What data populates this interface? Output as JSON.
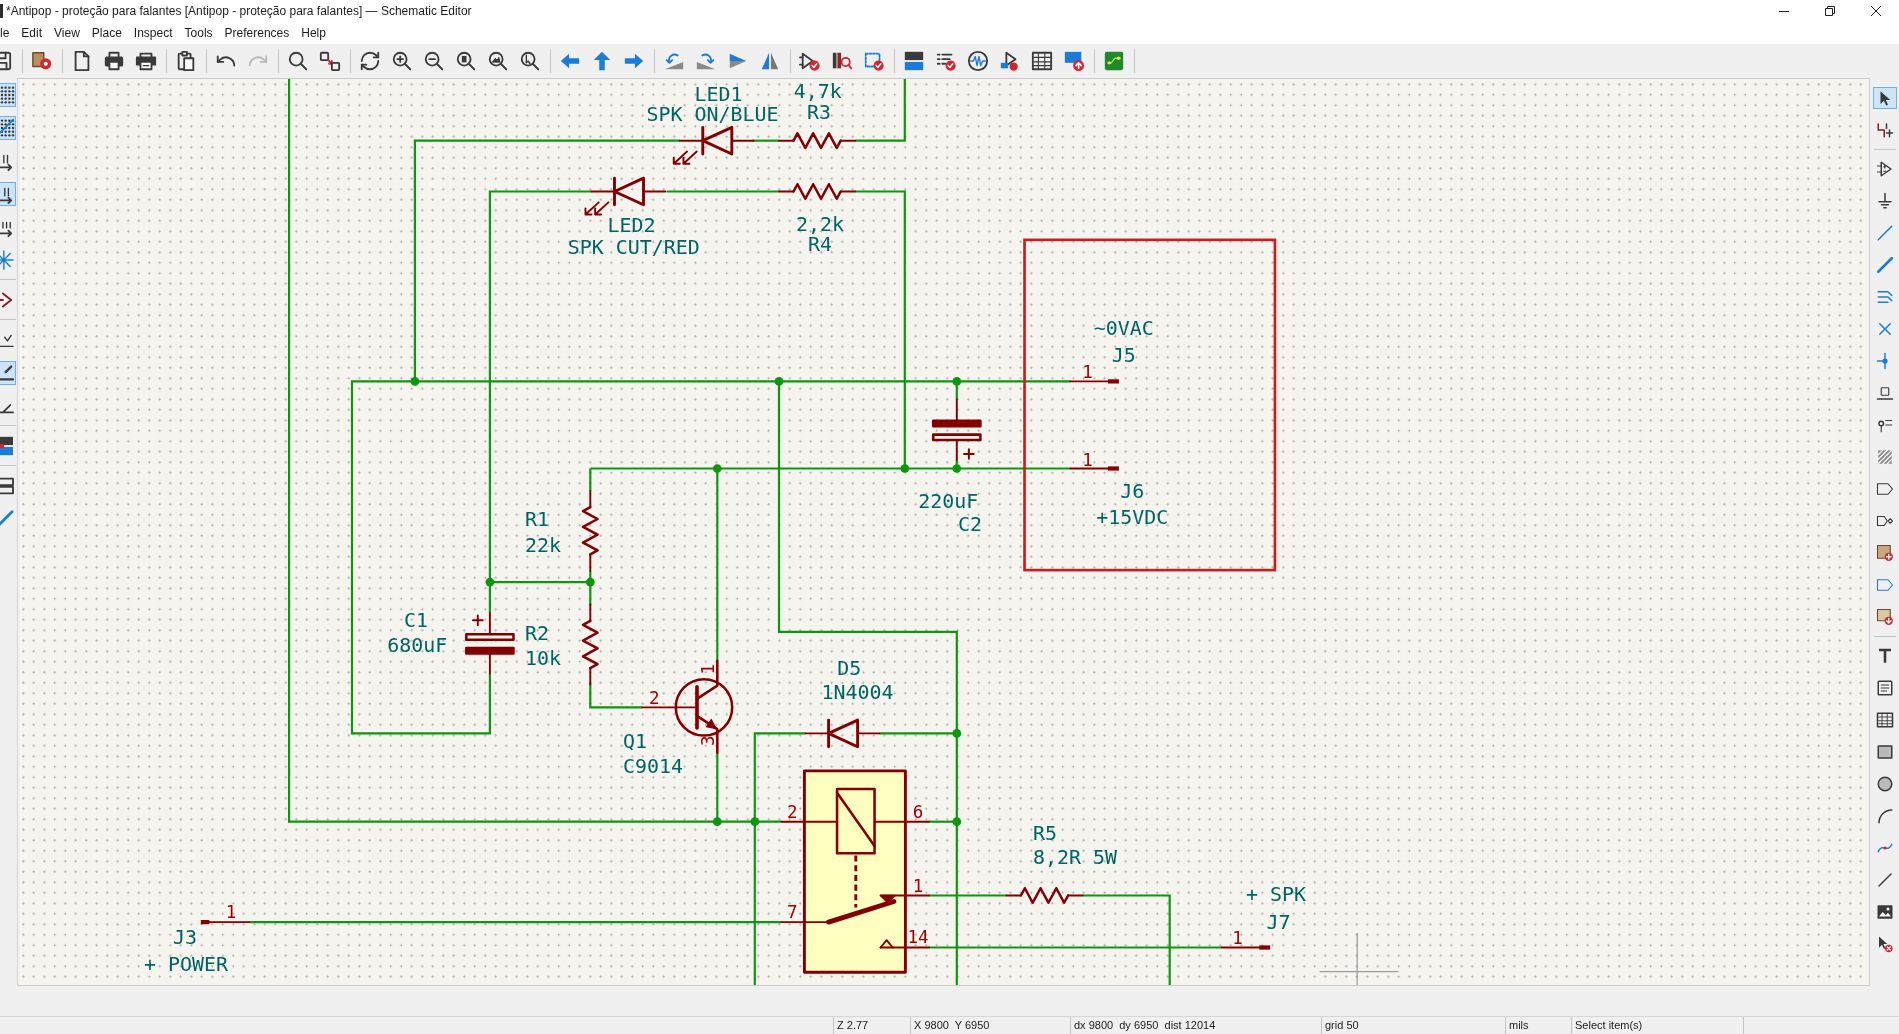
{
  "window": {
    "title": "*Antipop - proteção para falantes [Antipop - proteção para falantes] — Schematic Editor"
  },
  "menu_bar": [
    "le",
    "Edit",
    "View",
    "Place",
    "Inspect",
    "Tools",
    "Preferences",
    "Help"
  ],
  "toolbar": {
    "groups": [
      [
        {
          "kind": "save",
          "disabled": false
        }
      ],
      [
        {
          "kind": "symbol-settings",
          "disabled": false
        }
      ],
      [
        {
          "kind": "new-page",
          "disabled": false
        },
        {
          "kind": "print",
          "disabled": false
        },
        {
          "kind": "plot",
          "disabled": false
        }
      ],
      [
        {
          "kind": "paste",
          "disabled": false
        }
      ],
      [
        {
          "kind": "undo",
          "disabled": false
        },
        {
          "kind": "redo",
          "disabled": true
        }
      ],
      [
        {
          "kind": "find",
          "disabled": false
        },
        {
          "kind": "find-replace",
          "disabled": false
        }
      ],
      [
        {
          "kind": "refresh",
          "disabled": false
        },
        {
          "kind": "zoom-in",
          "disabled": false
        },
        {
          "kind": "zoom-out",
          "disabled": false
        },
        {
          "kind": "zoom-fit",
          "disabled": false
        },
        {
          "kind": "zoom-objects",
          "disabled": false
        },
        {
          "kind": "zoom-selection",
          "disabled": false
        }
      ],
      [
        {
          "kind": "nav-back",
          "disabled": false
        },
        {
          "kind": "nav-up",
          "disabled": false
        },
        {
          "kind": "nav-forward",
          "disabled": false
        }
      ],
      [
        {
          "kind": "rotate-ccw",
          "disabled": false
        },
        {
          "kind": "rotate-cw",
          "disabled": false
        },
        {
          "kind": "mirror-x",
          "disabled": false
        },
        {
          "kind": "mirror-y",
          "disabled": false
        }
      ],
      [
        {
          "kind": "erc",
          "disabled": false
        },
        {
          "kind": "library",
          "disabled": false
        },
        {
          "kind": "symbol-checker",
          "disabled": false
        }
      ],
      [
        {
          "kind": "annotate",
          "disabled": false
        },
        {
          "kind": "erc-list",
          "disabled": false
        },
        {
          "kind": "simulator",
          "disabled": false
        },
        {
          "kind": "symbol-fields",
          "disabled": false
        },
        {
          "kind": "table",
          "disabled": false
        },
        {
          "kind": "bom",
          "disabled": false
        }
      ],
      [
        {
          "kind": "pcb",
          "disabled": false
        }
      ]
    ]
  },
  "left_toolbar": {
    "groups": [
      [
        {
          "kind": "grid",
          "selected": true
        },
        {
          "kind": "grid-overrides",
          "selected": true
        },
        {
          "kind": "units-inch",
          "selected": false
        },
        {
          "kind": "units-mil",
          "selected": true
        },
        {
          "kind": "units-mm",
          "selected": false
        },
        {
          "kind": "cursor",
          "selected": false
        }
      ],
      [
        {
          "kind": "pins",
          "selected": false
        }
      ],
      [
        {
          "kind": "line-free",
          "selected": false
        },
        {
          "kind": "line-90",
          "selected": true
        },
        {
          "kind": "line-45",
          "selected": false
        }
      ],
      [
        {
          "kind": "annotate",
          "selected": false
        }
      ],
      [
        {
          "kind": "hierarchy",
          "selected": false
        },
        {
          "kind": "properties",
          "selected": false
        }
      ]
    ]
  },
  "schematic": {
    "symbols": [
      {
        "kind": "led",
        "reference": "LED1",
        "value": "SPK ON/BLUE"
      },
      {
        "kind": "resistor",
        "reference": "R3",
        "value": "4,7k"
      },
      {
        "kind": "led",
        "reference": "LED2",
        "value": "SPK CUT/RED"
      },
      {
        "kind": "resistor",
        "reference": "R4",
        "value": "2,2k"
      },
      {
        "kind": "connector",
        "reference": "J5",
        "value": "~0VAC",
        "pins": [
          "1"
        ]
      },
      {
        "kind": "capacitor",
        "reference": "C2",
        "value": "220uF"
      },
      {
        "kind": "connector",
        "reference": "J6",
        "value": "+15VDC",
        "pins": [
          "1"
        ]
      },
      {
        "kind": "resistor",
        "reference": "R1",
        "value": "22k"
      },
      {
        "kind": "capacitor",
        "reference": "C1",
        "value": "680uF"
      },
      {
        "kind": "resistor",
        "reference": "R2",
        "value": "10k"
      },
      {
        "kind": "transistor",
        "reference": "Q1",
        "value": "C9014",
        "pins": [
          "2",
          "1",
          "3"
        ]
      },
      {
        "kind": "diode",
        "reference": "D5",
        "value": "1N4004"
      },
      {
        "kind": "relay",
        "pins": [
          "2",
          "6",
          "1",
          "7",
          "14"
        ]
      },
      {
        "kind": "resistor",
        "reference": "R5",
        "value": "8,2R 5W"
      },
      {
        "kind": "connector",
        "reference": "J3",
        "value": "+ POWER",
        "pins": [
          "1"
        ]
      },
      {
        "kind": "connector",
        "reference": "J7",
        "value": "+ SPK",
        "pins": [
          "1"
        ]
      }
    ]
  },
  "right_toolbar": {
    "groups": [
      [
        {
          "kind": "select",
          "selected": true
        },
        {
          "kind": "net-highlight",
          "selected": false
        }
      ],
      [
        {
          "kind": "symbol",
          "selected": false
        },
        {
          "kind": "power",
          "selected": false
        },
        {
          "kind": "wire",
          "selected": false
        },
        {
          "kind": "bus",
          "selected": false
        },
        {
          "kind": "bus-entry",
          "selected": false
        },
        {
          "kind": "no-connect",
          "selected": false
        },
        {
          "kind": "junction",
          "selected": false
        },
        {
          "kind": "label",
          "selected": false
        },
        {
          "kind": "netclass",
          "selected": false
        },
        {
          "kind": "rule-area",
          "selected": false
        },
        {
          "kind": "global-label",
          "selected": false
        },
        {
          "kind": "hier-label",
          "selected": false
        },
        {
          "kind": "sheet",
          "selected": false
        },
        {
          "kind": "import-pin",
          "selected": false
        },
        {
          "kind": "sheet-pin",
          "selected": false
        }
      ],
      [
        {
          "kind": "text",
          "selected": false
        },
        {
          "kind": "textbox",
          "selected": false
        },
        {
          "kind": "table",
          "selected": false
        },
        {
          "kind": "rectangle",
          "selected": false
        },
        {
          "kind": "circle",
          "selected": false
        },
        {
          "kind": "arc",
          "selected": false
        },
        {
          "kind": "bezier",
          "selected": false
        },
        {
          "kind": "line",
          "selected": false
        },
        {
          "kind": "image",
          "selected": false
        },
        {
          "kind": "delete",
          "selected": false
        }
      ]
    ]
  },
  "status_bar": {
    "fields": [
      "Z 2.77",
      "X 9800  Y 6950",
      "dx 9800  dy 6950  dist 12014",
      "grid 50",
      "mils",
      "Select item(s)"
    ]
  }
}
